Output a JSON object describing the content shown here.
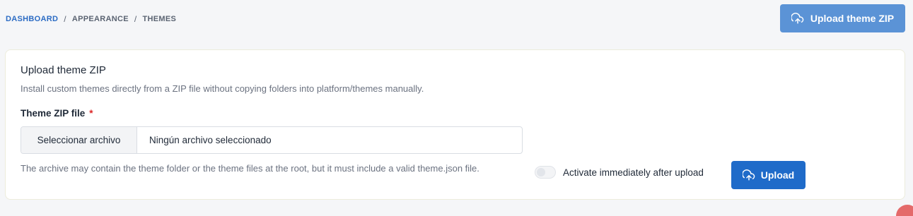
{
  "breadcrumb": {
    "items": [
      "DASHBOARD",
      "APPEARANCE",
      "THEMES"
    ],
    "separator": "/"
  },
  "header": {
    "upload_button_label": "Upload theme ZIP",
    "upload_button_icon": "cloud-upload-icon"
  },
  "card": {
    "title": "Upload theme ZIP",
    "description": "Install custom themes directly from a ZIP file without copying folders into platform/themes manually.",
    "field_label": "Theme ZIP file",
    "required_marker": "*",
    "file_input": {
      "button_label": "Seleccionar archivo",
      "value": "Ningún archivo seleccionado"
    },
    "help_text": "The archive may contain the theme folder or the theme files at the root, but it must include a valid theme.json file.",
    "toggle": {
      "label": "Activate immediately after upload",
      "checked": false
    },
    "submit_button_label": "Upload",
    "submit_button_icon": "cloud-upload-icon"
  },
  "colors": {
    "primary": "#1f6bc9",
    "primary_light": "#5b93d6",
    "link": "#2c6cc4",
    "required": "#dc2626",
    "background": "#f5f6f8"
  }
}
